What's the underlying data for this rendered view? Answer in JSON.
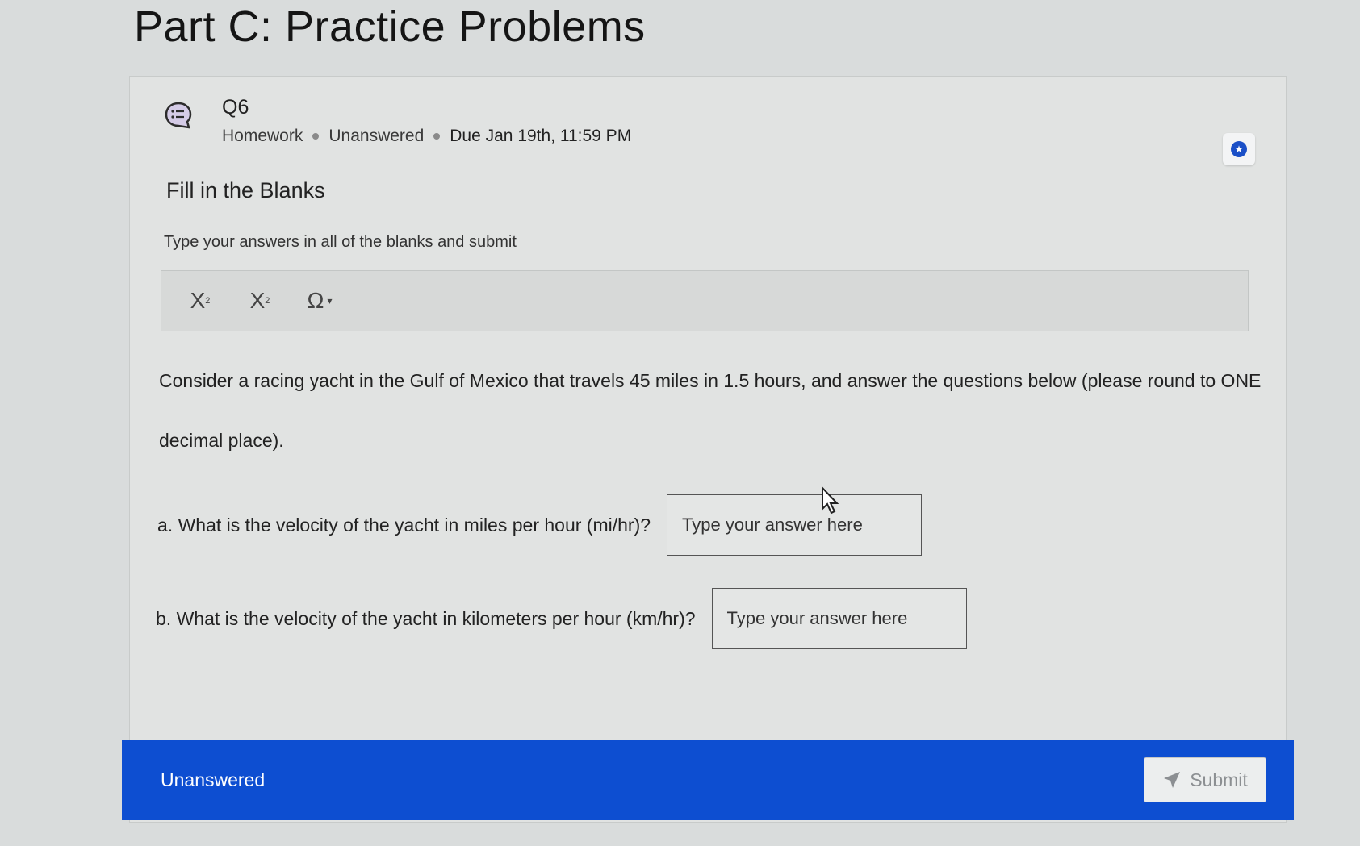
{
  "page": {
    "title": "Part C: Practice Problems"
  },
  "question": {
    "label": "Q6",
    "meta": {
      "type": "Homework",
      "status": "Unanswered",
      "due": "Due Jan 19th, 11:59 PM"
    },
    "section_title": "Fill in the Blanks",
    "instructions": "Type your answers in all of the blanks and submit",
    "toolbar": {
      "subscript_label": "X",
      "superscript_label": "X",
      "symbol_label": "Ω"
    },
    "body": "Consider a racing yacht in the Gulf of Mexico that travels 45 miles in 1.5 hours, and answer the questions below (please round to ONE decimal place).",
    "parts": [
      {
        "label": "a.  What is the velocity of the yacht in miles per hour (mi/hr)?",
        "placeholder": "Type your answer here",
        "value": ""
      },
      {
        "label": "b.  What is the velocity of the yacht in kilometers per hour (km/hr)?",
        "placeholder": "Type your answer here",
        "value": ""
      }
    ]
  },
  "footer": {
    "status": "Unanswered",
    "submit_label": "Submit"
  },
  "colors": {
    "accent": "#0d4ed1",
    "background": "#d9dcdc"
  }
}
